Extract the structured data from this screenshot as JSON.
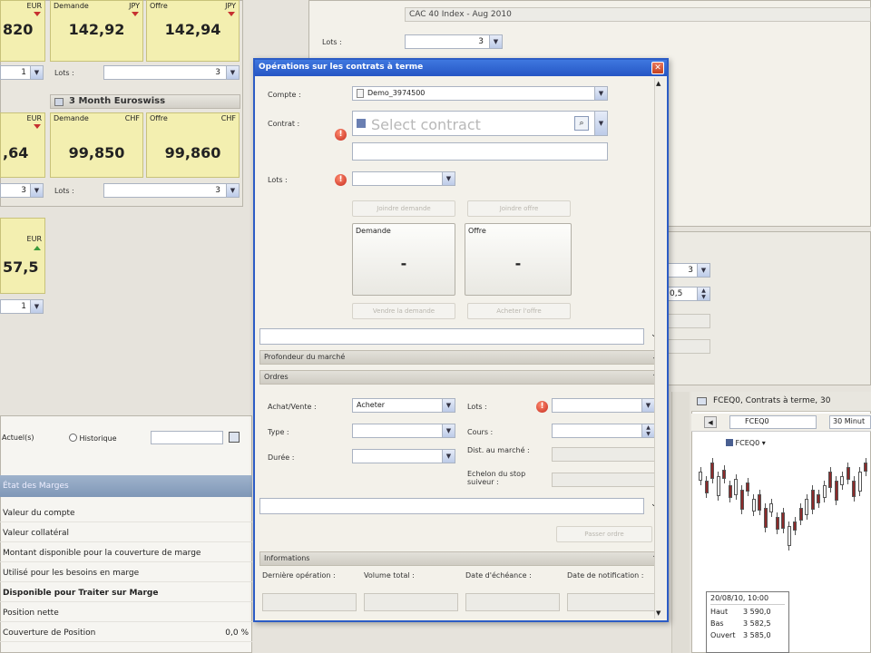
{
  "quotes": [
    {
      "demand_label": "Demande",
      "demand_cur": "JPY",
      "offer_label": "Offre",
      "offer_cur": "JPY",
      "demand": "142,92",
      "offer": "142,94",
      "left_val": "820",
      "left_cur": "EUR",
      "lots_label": "Lots :",
      "lots": "3"
    },
    {
      "title": "3 Month Euroswiss",
      "demand_label": "Demande",
      "demand_cur": "CHF",
      "offer_label": "Offre",
      "offer_cur": "CHF",
      "demand": "99,850",
      "offer": "99,860",
      "left_val": ",64",
      "left_cur": "EUR",
      "lots_label": "Lots :",
      "lots": "3"
    }
  ],
  "left_quote3": {
    "cur": "EUR",
    "val": "57,5",
    "lots": "1"
  },
  "bg_top": {
    "contract_name": "CAC 40 Index - Aug 2010",
    "lots_label": "Lots :",
    "lots": "3"
  },
  "right_mid": {
    "lots1": "3",
    "val2": "0,5"
  },
  "dialog": {
    "title": "Opérations sur les contrats à terme",
    "compte_label": "Compte :",
    "compte_value": "Demo_3974500",
    "contrat_label": "Contrat :",
    "contrat_placeholder": "Select contract",
    "lots_label": "Lots :",
    "btn_demande": "Joindre demande",
    "btn_offre": "Joindre offre",
    "box_demande_label": "Demande",
    "box_demande_value": "-",
    "box_offre_label": "Offre",
    "box_offre_value": "-",
    "btn_vendre": "Vendre la demande",
    "btn_acheter": "Acheter l'offre",
    "section_depth": "Profondeur du marché",
    "section_orders": "Ordres",
    "achat_label": "Achat/Vente :",
    "achat_value": "Acheter",
    "lots2_label": "Lots :",
    "type_label": "Type :",
    "cours_label": "Cours :",
    "duree_label": "Durée :",
    "dist_label": "Dist. au marché :",
    "echelon_label": "Echelon du stop suiveur :",
    "btn_passer": "Passer ordre",
    "section_info": "Informations",
    "info_cols": [
      "Dernière opération :",
      "Volume total :",
      "Date d'échéance :",
      "Date de notification :"
    ]
  },
  "bottom_left": {
    "radio_actuel": "Actuel(s)",
    "radio_hist": "Historique",
    "header": "État des Marges",
    "rows": [
      {
        "label": "Valeur du compte",
        "value": ""
      },
      {
        "label": "Valeur collatéral",
        "value": ""
      },
      {
        "label": "Montant disponible pour la couverture de marge",
        "value": ""
      },
      {
        "label": "Utilisé pour les besoins en marge",
        "value": ""
      },
      {
        "label": "Disponible pour Traiter sur Marge",
        "value": ""
      },
      {
        "label": "Position nette",
        "value": ""
      },
      {
        "label": "Couverture de Position",
        "value": "0,0 %"
      }
    ]
  },
  "chart_panel": {
    "title": "FCEQ0, Contrats à terme, 30",
    "symbol": "FCEQ0",
    "interval": "30 Minut",
    "legend": "FCEQ0",
    "tooltip_date": "20/08/10, 10:00",
    "tooltip_rows": [
      {
        "k": "Haut",
        "v": "3 590,0"
      },
      {
        "k": "Bas",
        "v": "3 582,5"
      },
      {
        "k": "Ouvert",
        "v": "3 585,0"
      }
    ]
  }
}
